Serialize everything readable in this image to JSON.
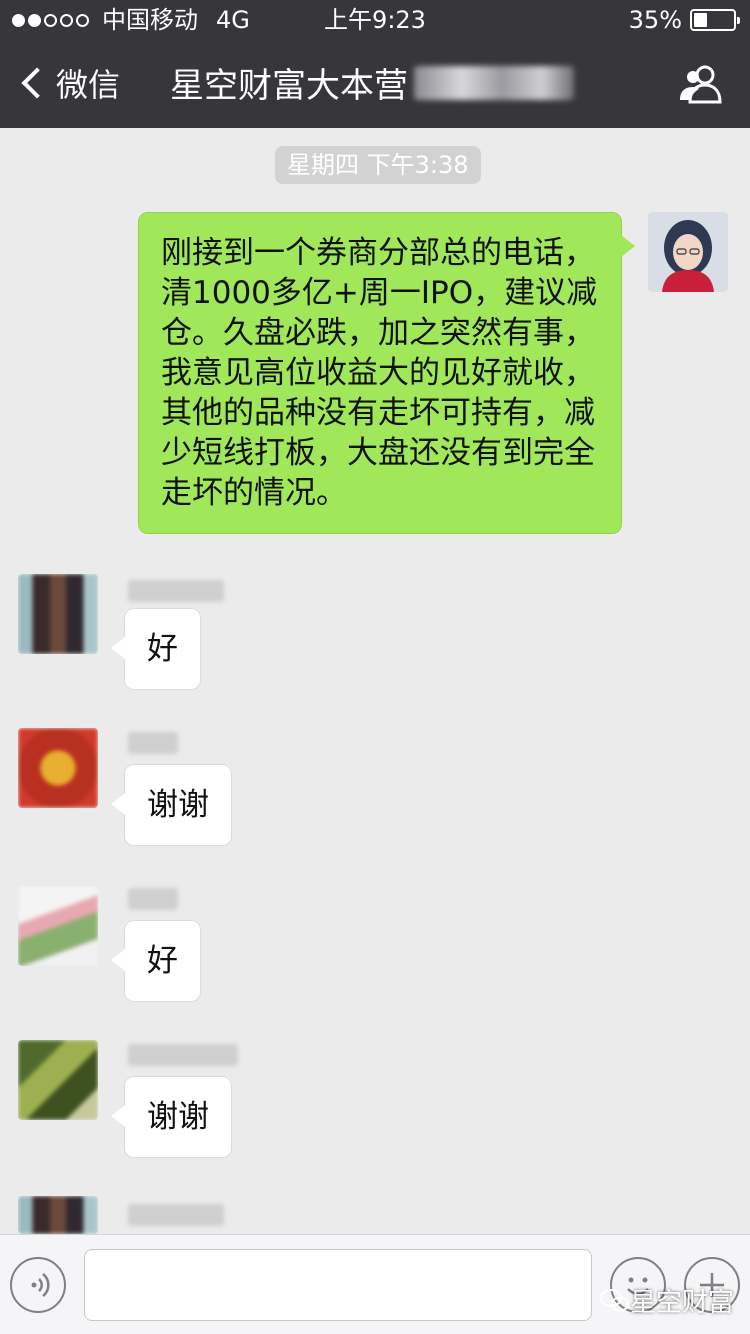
{
  "status_bar": {
    "signal_dots_filled": 2,
    "signal_dots_total": 5,
    "carrier": "中国移动",
    "network": "4G",
    "time": "上午9:23",
    "battery_percent": "35%",
    "battery_level": 0.35
  },
  "nav": {
    "back_label": "微信",
    "title": "星空财富大本营",
    "contacts_icon": "group-people-icon"
  },
  "chat": {
    "timestamp": "星期四 下午3:38",
    "messages": [
      {
        "direction": "out",
        "text": "刚接到一个券商分部总的电话，清1000多亿+周一IPO，建议减仓。久盘必跌，加之突然有事，我意见高位收益大的见好就收，其他的品种没有走坏可持有，减少短线打板，大盘还没有到完全走坏的情况。"
      },
      {
        "direction": "in",
        "text": "好"
      },
      {
        "direction": "in",
        "text": "谢谢"
      },
      {
        "direction": "in",
        "text": "好"
      },
      {
        "direction": "in",
        "text": "谢谢"
      }
    ]
  },
  "input_bar": {
    "voice_icon": "voice-wave-icon",
    "emoji_icon": "smiley-icon",
    "more_icon": "plus-icon",
    "input_value": ""
  },
  "watermark": {
    "text": "星空财富",
    "icon": "wechat-logo-icon"
  },
  "colors": {
    "nav_bg": "#36363b",
    "chat_bg": "#ebebeb",
    "out_bubble": "#a0e75a",
    "in_bubble": "#ffffff"
  }
}
